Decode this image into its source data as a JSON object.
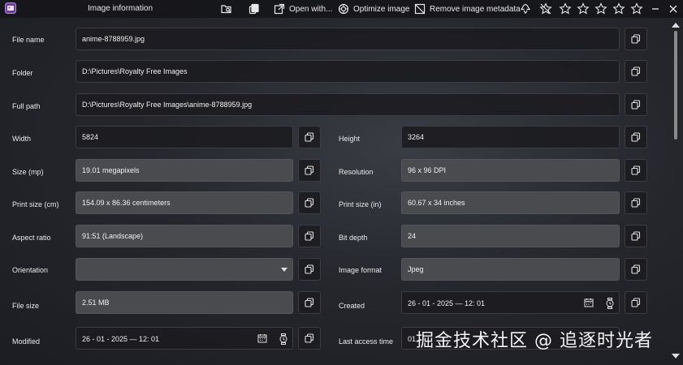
{
  "titlebar": {
    "title": "Image information",
    "open_with_label": "Open with...",
    "optimize_label": "Optimize image",
    "remove_metadata_label": "Remove image metadata",
    "rating_stars": 5,
    "rating_value": 0
  },
  "fields": {
    "file_name": {
      "label": "File name",
      "value": "anime-8788959.jpg"
    },
    "folder": {
      "label": "Folder",
      "value": "D:\\Pictures\\Royalty Free Images"
    },
    "full_path": {
      "label": "Full path",
      "value": "D:\\Pictures\\Royalty Free Images\\anime-8788959.jpg"
    },
    "width": {
      "label": "Width",
      "value": "5824"
    },
    "height": {
      "label": "Height",
      "value": "3264"
    },
    "size_mp": {
      "label": "Size (mp)",
      "value": "19.01 megapixels"
    },
    "resolution": {
      "label": "Resolution",
      "value": "96 x 96 DPI"
    },
    "print_size_cm": {
      "label": "Print size (cm)",
      "value": "154.09 x 86.36 centimeters"
    },
    "print_size_in": {
      "label": "Print size (in)",
      "value": "60.67 x 34 inches"
    },
    "aspect_ratio": {
      "label": "Aspect ratio",
      "value": "91:51 (Landscape)"
    },
    "bit_depth": {
      "label": "Bit depth",
      "value": "24"
    },
    "orientation": {
      "label": "Orientation",
      "value": ""
    },
    "image_format": {
      "label": "Image format",
      "value": "Jpeg"
    },
    "file_size": {
      "label": "File size",
      "value": "2.51 MB"
    },
    "created": {
      "label": "Created",
      "value": "26  -  01  -  2025  —  12: 01"
    },
    "modified": {
      "label": "Modified",
      "value": "26  -  01  -  2025  —  12: 01"
    },
    "last_access_time": {
      "label": "Last access time",
      "value": "01"
    }
  },
  "watermark": "掘金技术社区 @ 追逐时光者",
  "colors": {
    "editable_field_bg": "#1c1c20",
    "readonly_field_bg": "#4a4b4f",
    "text": "#f0f0f0"
  }
}
